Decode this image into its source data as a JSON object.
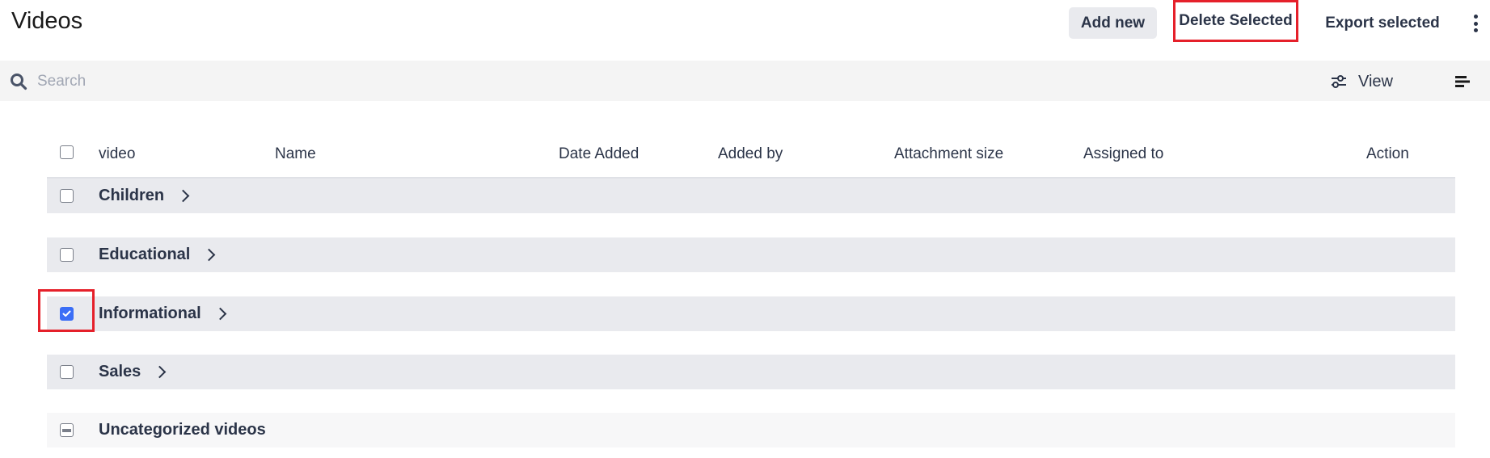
{
  "page": {
    "title": "Videos"
  },
  "toolbar": {
    "add_new_label": "Add new",
    "delete_selected_label": "Delete Selected",
    "export_selected_label": "Export selected",
    "more_icon": "kebab-vertical-icon"
  },
  "search": {
    "placeholder": "Search",
    "value": "",
    "view_label": "View",
    "view_icon": "sliders-icon",
    "sort_icon": "sort-lines-icon"
  },
  "table": {
    "columns": [
      "video",
      "Name",
      "Date Added",
      "Added by",
      "Attachment size",
      "Assigned to",
      "Action"
    ],
    "select_all_checked": false,
    "rows": [
      {
        "label": "Children",
        "checked": false,
        "expandable": true
      },
      {
        "label": "Educational",
        "checked": false,
        "expandable": true
      },
      {
        "label": "Informational",
        "checked": true,
        "expandable": true
      },
      {
        "label": "Sales",
        "checked": false,
        "expandable": true
      },
      {
        "label": "Uncategorized videos",
        "checked": "indeterminate",
        "expandable": false
      }
    ]
  },
  "colors": {
    "accent": "#3b6ef6",
    "highlight_border": "#e5202a",
    "row_bg": "#e9eaee",
    "text": "#2b3448"
  }
}
